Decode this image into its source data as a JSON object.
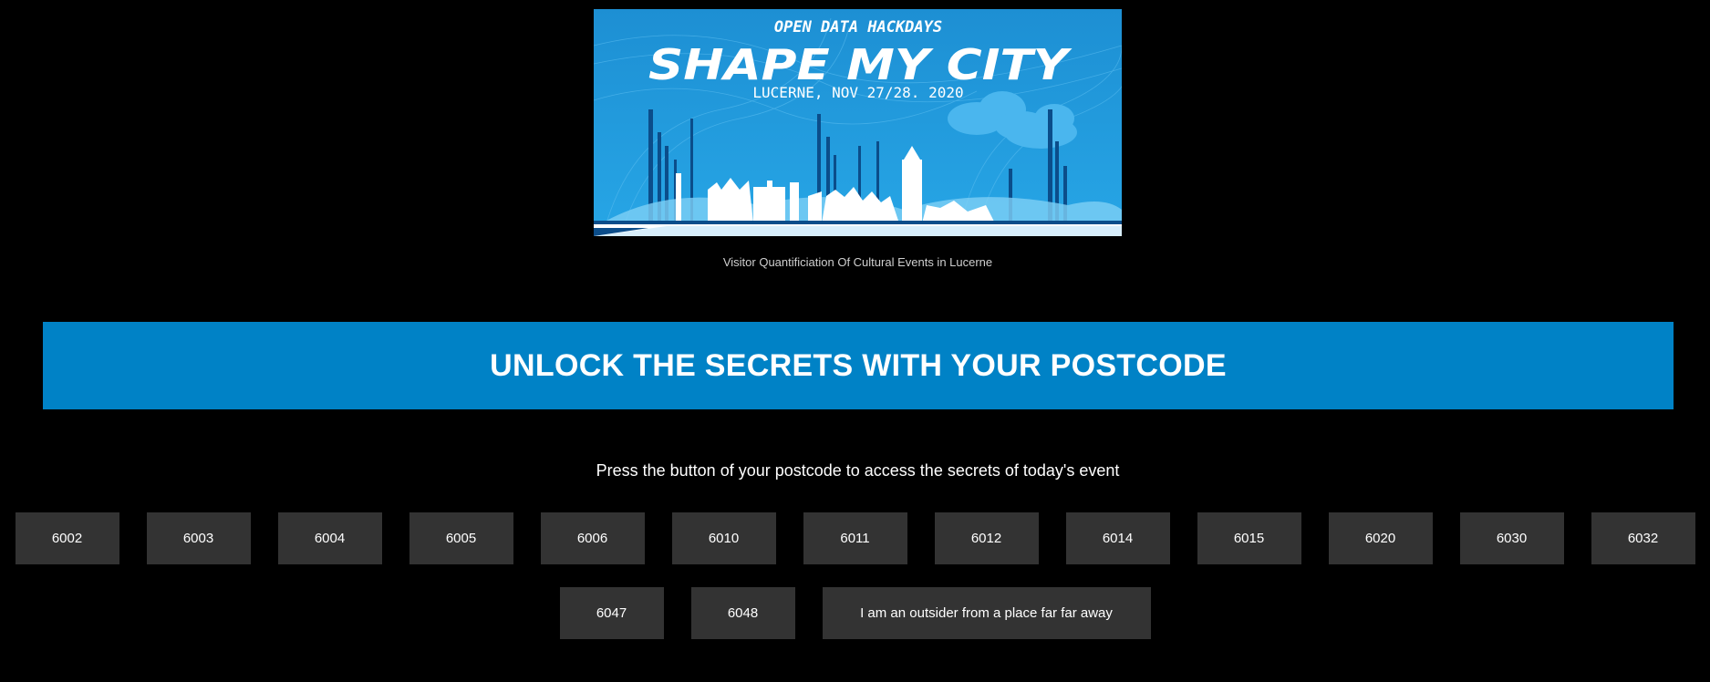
{
  "banner": {
    "kicker": "OPEN DATA HACKDAYS",
    "title": "SHAPE MY CITY",
    "subtitle": "LUCERNE, NOV 27/28. 2020"
  },
  "caption": "Visitor Quantificiation Of Cultural Events in Lucerne",
  "headline": "UNLOCK THE SECRETS WITH YOUR POSTCODE",
  "instruction": "Press the button of your postcode to access the secrets of today's event",
  "postcodes_row1": [
    "6002",
    "6003",
    "6004",
    "6005",
    "6006",
    "6010",
    "6011",
    "6012",
    "6014",
    "6015",
    "6020",
    "6030",
    "6032"
  ],
  "postcodes_row2": [
    "6047",
    "6048"
  ],
  "outsider_button": "I am an outsider from a place far far away",
  "colors": {
    "background": "#000000",
    "accent": "#0082c6",
    "button": "#333333",
    "banner_blue": "#1e96d8"
  }
}
